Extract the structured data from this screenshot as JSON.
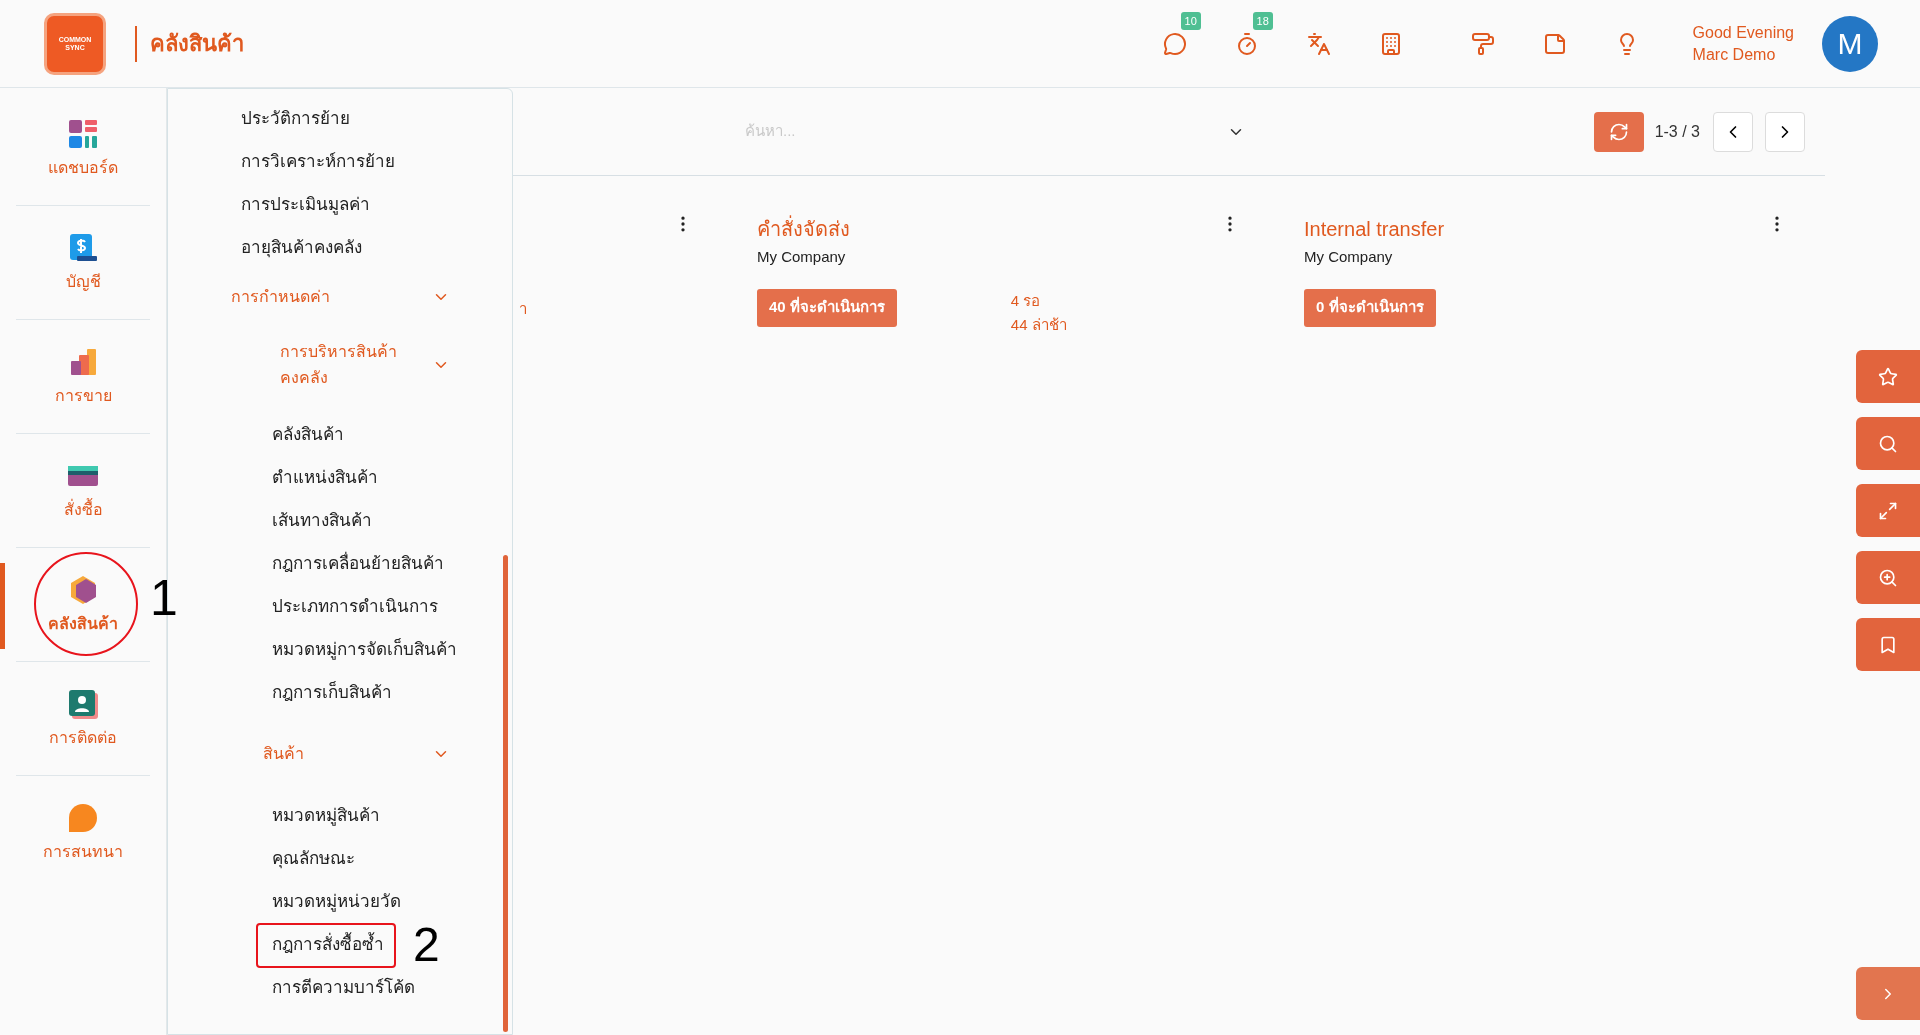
{
  "header": {
    "logo_text": "COMMON SYNC",
    "title": "คลังสินค้า",
    "icons": [
      {
        "kind": "chat",
        "badge": "10"
      },
      {
        "kind": "timer",
        "badge": "18"
      },
      {
        "kind": "translate"
      },
      {
        "kind": "building"
      },
      {
        "kind": "roller"
      },
      {
        "kind": "note"
      },
      {
        "kind": "bulb"
      }
    ],
    "greeting": "Good Evening",
    "user": "Marc Demo",
    "avatar": "M"
  },
  "sidebar": {
    "items": [
      {
        "kind": "dashboard",
        "label": "แดชบอร์ด",
        "selected": false,
        "marked": false
      },
      {
        "kind": "accounting",
        "label": "บัญชี",
        "selected": false,
        "marked": false
      },
      {
        "kind": "sales",
        "label": "การขาย",
        "selected": false,
        "marked": false
      },
      {
        "kind": "purchase",
        "label": "สั่งซื้อ",
        "selected": false,
        "marked": false
      },
      {
        "kind": "inventory",
        "label": "คลังสินค้า",
        "selected": true,
        "marked": true
      },
      {
        "kind": "contacts",
        "label": "การติดต่อ",
        "selected": false,
        "marked": false
      },
      {
        "kind": "chat",
        "label": "การสนทนา",
        "selected": false,
        "marked": false
      }
    ]
  },
  "menu": [
    {
      "kind": "item",
      "label": "ประวัติการย้าย",
      "marked": false
    },
    {
      "kind": "item",
      "label": "การวิเคราะห์การย้าย",
      "marked": false
    },
    {
      "kind": "item",
      "label": "การประเมินมูลค่า",
      "marked": false
    },
    {
      "kind": "item",
      "label": "อายุสินค้าคงคลัง",
      "marked": false
    },
    {
      "kind": "group",
      "label": "การกำหนดค่า",
      "expanded": true,
      "children": [
        {
          "kind": "group",
          "label": "การบริหารสินค้าคงคลัง",
          "expanded": true,
          "children": [
            {
              "kind": "item",
              "label": "คลังสินค้า",
              "marked": false
            },
            {
              "kind": "item",
              "label": "ตำแหน่งสินค้า",
              "marked": false
            },
            {
              "kind": "item",
              "label": "เส้นทางสินค้า",
              "marked": false
            },
            {
              "kind": "item",
              "label": "กฎการเคลื่อนย้ายสินค้า",
              "marked": false
            },
            {
              "kind": "item",
              "label": "ประเภทการดำเนินการ",
              "marked": false
            },
            {
              "kind": "item",
              "label": "หมวดหมู่การจัดเก็บสินค้า",
              "marked": false
            },
            {
              "kind": "item",
              "label": "กฎการเก็บสินค้า",
              "marked": false
            }
          ]
        },
        {
          "kind": "group",
          "label": "สินค้า",
          "expanded": true,
          "children": [
            {
              "kind": "item",
              "label": "หมวดหมู่สินค้า",
              "marked": false
            },
            {
              "kind": "item",
              "label": "คุณลักษณะ",
              "marked": false
            },
            {
              "kind": "item",
              "label": "หมวดหมู่หน่วยวัด",
              "marked": false
            },
            {
              "kind": "item",
              "label": "กฎการสั่งซื้อซ้ำ",
              "marked": true
            },
            {
              "kind": "item",
              "label": "การตีความบาร์โค้ด",
              "marked": false
            }
          ]
        }
      ]
    }
  ],
  "annotations": [
    {
      "label": "1"
    },
    {
      "label": "2"
    }
  ],
  "toolbar": {
    "search": {
      "placeholder": "ค้นหา..."
    },
    "pager": "1-3 / 3"
  },
  "cards": [
    {
      "fragment": "า"
    },
    {
      "title": "คำสั่งจัดส่ง",
      "company": "My Company",
      "action": "40 ที่จะดำเนินการ",
      "stats": [
        "4 รอ",
        "44 ล่าช้า"
      ]
    },
    {
      "title": "Internal transfer",
      "company": "My Company",
      "action": "0 ที่จะดำเนินการ"
    }
  ]
}
